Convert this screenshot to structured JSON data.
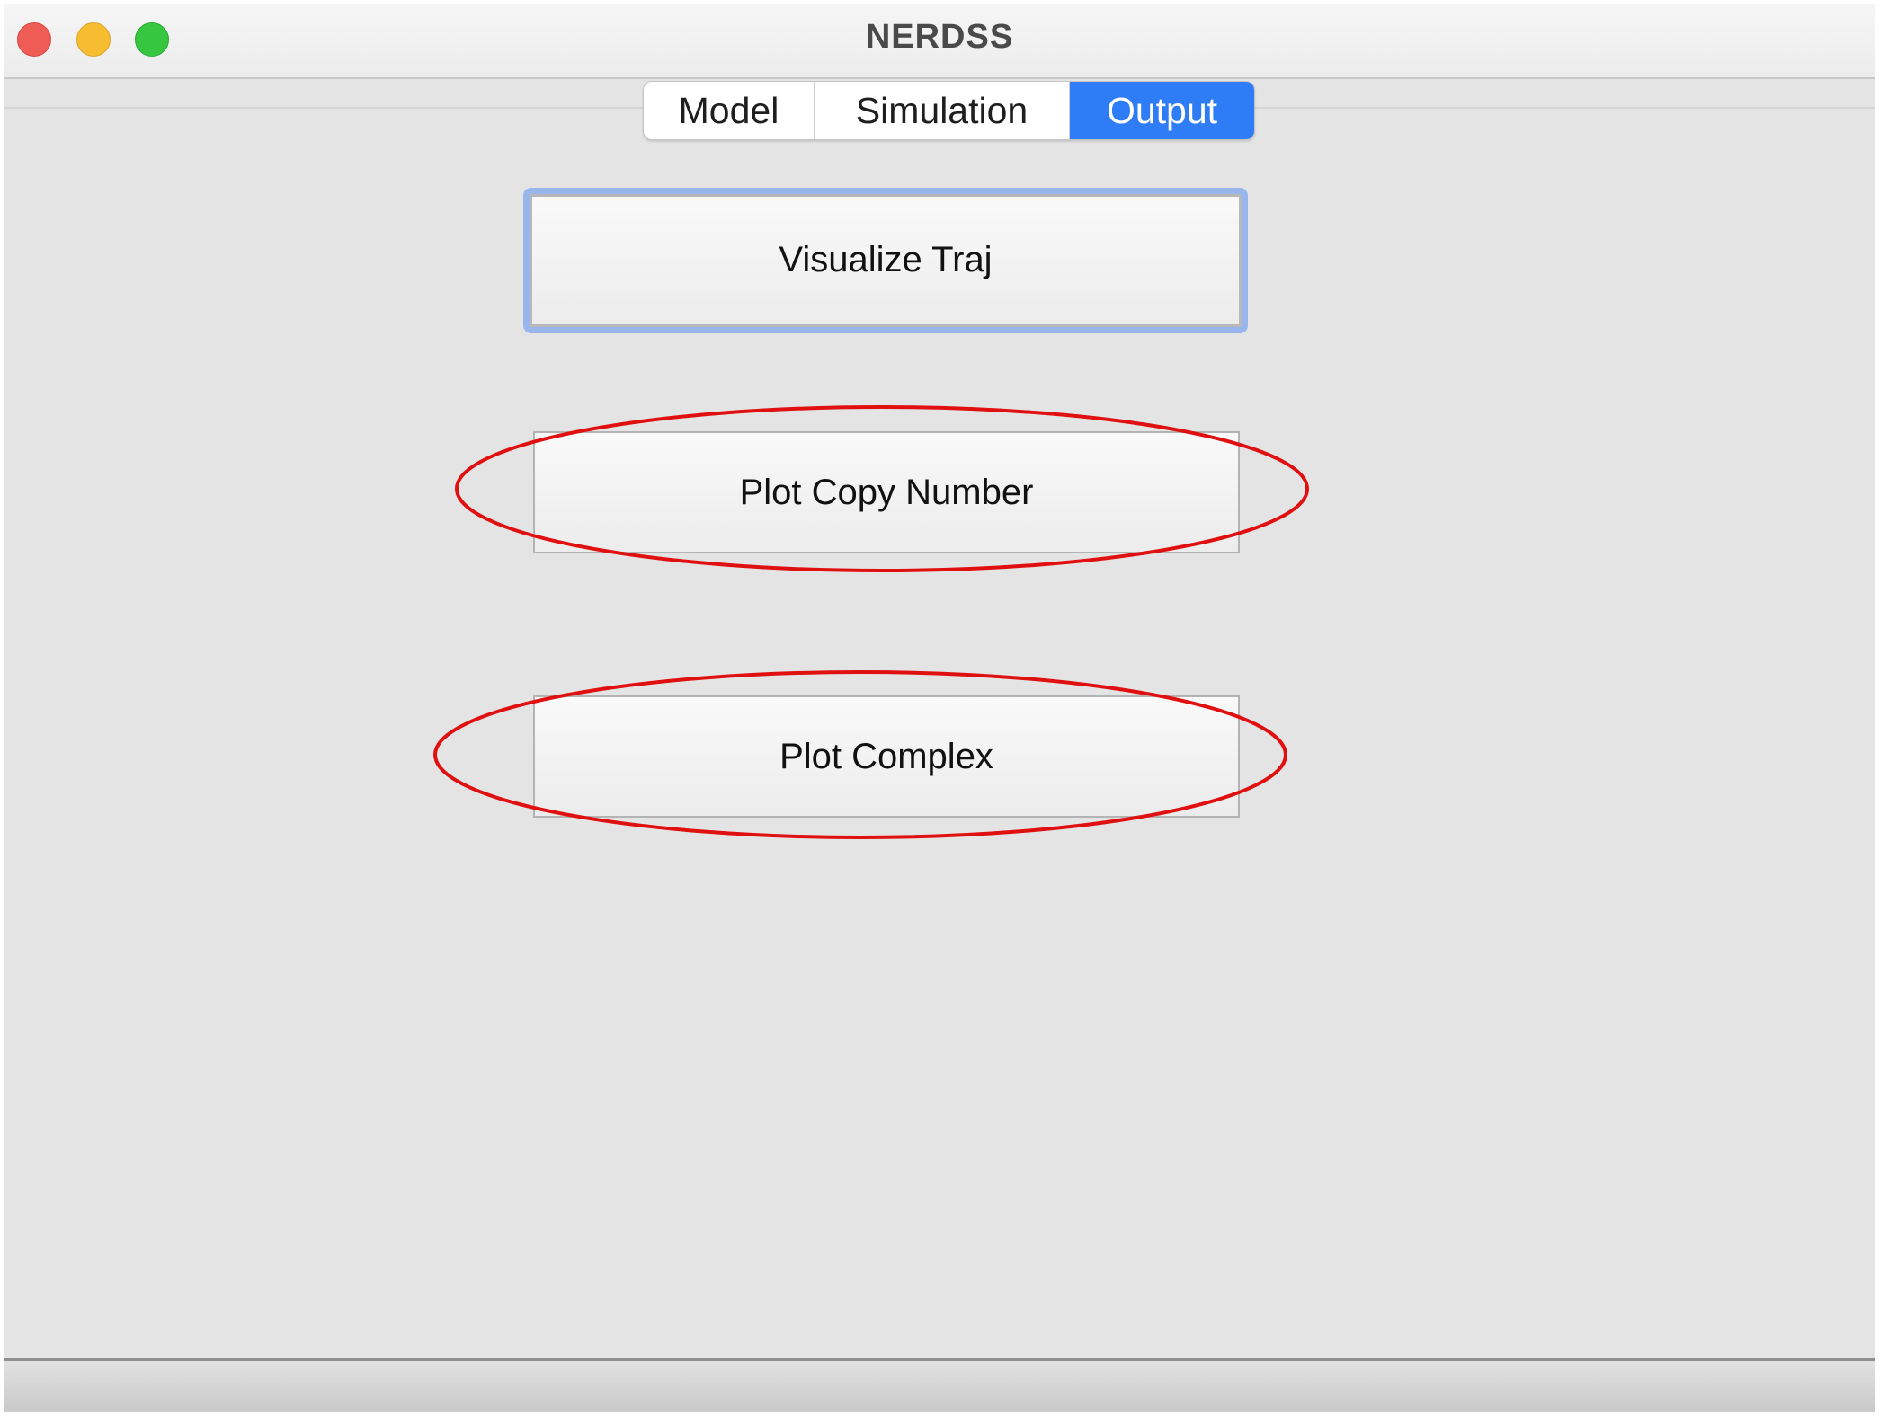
{
  "window": {
    "title": "NERDSS"
  },
  "tabs": [
    {
      "label": "Model",
      "selected": false
    },
    {
      "label": "Simulation",
      "selected": false
    },
    {
      "label": "Output",
      "selected": true
    }
  ],
  "buttons": {
    "visualize_label": "Visualize Traj",
    "copy_number_label": "Plot Copy Number",
    "complex_label": "Plot Complex"
  },
  "colors": {
    "selected_tab": "#2f7df6",
    "focus_ring": "#98b5ec",
    "annotation": "#e01010",
    "close": "#ef5b55",
    "minimize": "#f5bd2f",
    "maximize": "#37c63f"
  }
}
